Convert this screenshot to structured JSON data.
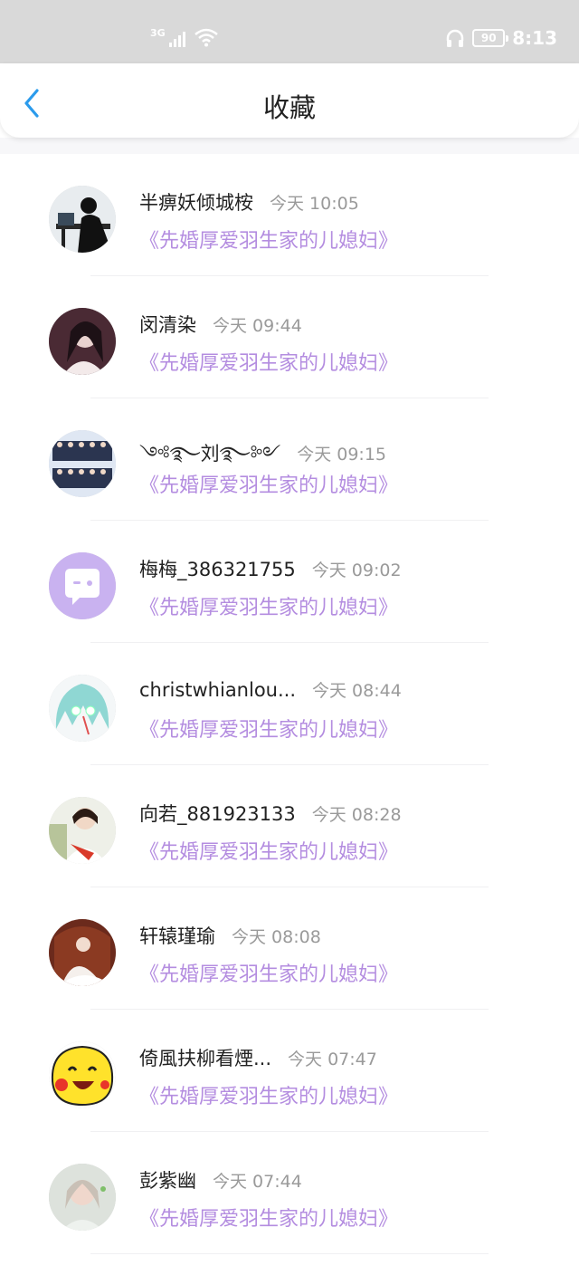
{
  "status_bar": {
    "network": "3G",
    "battery": "90",
    "time": "8:13"
  },
  "header": {
    "title": "收藏"
  },
  "items": [
    {
      "name": "半痹妖倾城桉",
      "time": "今天 10:05",
      "book": "《先婚厚爱羽生家的儿媳妇》"
    },
    {
      "name": "闵清染",
      "time": "今天 09:44",
      "book": "《先婚厚爱羽生家的儿媳妇》"
    },
    {
      "name": "༺࿐刘࿐༻",
      "time": "今天 09:15",
      "book": "《先婚厚爱羽生家的儿媳妇》"
    },
    {
      "name": "梅梅_386321755",
      "time": "今天 09:02",
      "book": "《先婚厚爱羽生家的儿媳妇》"
    },
    {
      "name": "christwhianlou...",
      "time": "今天 08:44",
      "book": "《先婚厚爱羽生家的儿媳妇》"
    },
    {
      "name": "向若_881923133",
      "time": "今天 08:28",
      "book": "《先婚厚爱羽生家的儿媳妇》"
    },
    {
      "name": "轩辕瑾瑜",
      "time": "今天 08:08",
      "book": "《先婚厚爱羽生家的儿媳妇》"
    },
    {
      "name": "倚風扶柳看煙...",
      "time": "今天 07:47",
      "book": "《先婚厚爱羽生家的儿媳妇》"
    },
    {
      "name": "彭紫幽",
      "time": "今天 07:44",
      "book": "《先婚厚爱羽生家的儿媳妇》"
    }
  ],
  "colors": {
    "accent": "#2b9bec",
    "book_title": "#b48de0",
    "status_bar": "#d9d9d9"
  }
}
